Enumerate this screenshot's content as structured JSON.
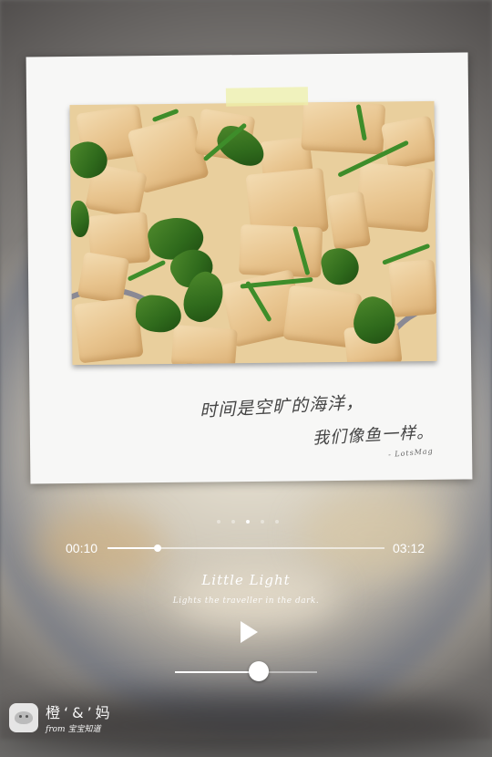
{
  "photo_caption": {
    "line1": "时间是空旷的海洋，",
    "line2": "我们像鱼一样。",
    "signature": "- LotsMag"
  },
  "player": {
    "elapsed": "00:10",
    "duration": "03:12",
    "progress_fraction": 0.18,
    "page_count": 5,
    "active_page": 3,
    "title": "Little Light",
    "subtitle": "Lights the traveller in the dark.",
    "volume_fraction": 0.59
  },
  "watermark": {
    "title": "橙‘&’妈",
    "subtitle": "from 宝宝知道"
  },
  "icons": {
    "play": "play-icon",
    "logo": "baby-face-icon"
  }
}
